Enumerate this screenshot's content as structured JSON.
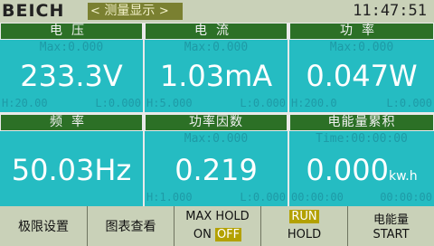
{
  "header": {
    "brand": "BEICH",
    "mode_prefix": "<",
    "mode_label": "测量显示",
    "mode_suffix": ">",
    "clock": "11:47:51"
  },
  "panels": {
    "voltage": {
      "title": "电压",
      "max": "Max:0.000",
      "value": "233.3V",
      "h": "H:20.00",
      "l": "L:0.000"
    },
    "current": {
      "title": "电流",
      "max": "Max:0.000",
      "value": "1.03mA",
      "h": "H:5.000",
      "l": "L:0.000"
    },
    "power": {
      "title": "功率",
      "max": "Max:0.000",
      "value": "0.047W",
      "h": "H:200.0",
      "l": "L:0.000"
    },
    "frequency": {
      "title": "频率",
      "value": "50.03Hz"
    },
    "power_factor": {
      "title": "功率因数",
      "max": "Max:0.000",
      "value": "0.219",
      "h": "H:1.000",
      "l": "L:0.000"
    },
    "energy": {
      "title": "电能量累积",
      "time": "Time:00:00:00",
      "value": "0.000",
      "unit": "kw.h",
      "t1": "00:00:00",
      "t2": "00:00:00"
    }
  },
  "softkeys": {
    "limit": "极限设置",
    "chart": "图表查看",
    "maxhold_top": "MAX HOLD",
    "maxhold_on": "ON",
    "maxhold_off": "OFF",
    "run": "RUN",
    "hold": "HOLD",
    "energy_top": "电能量",
    "energy_start": "START"
  },
  "colors": {
    "background": "#c9d1b8",
    "panel": "#25bcc2",
    "header": "#2c7026",
    "mode_bg": "#7a8031",
    "highlight": "#b3a100"
  }
}
